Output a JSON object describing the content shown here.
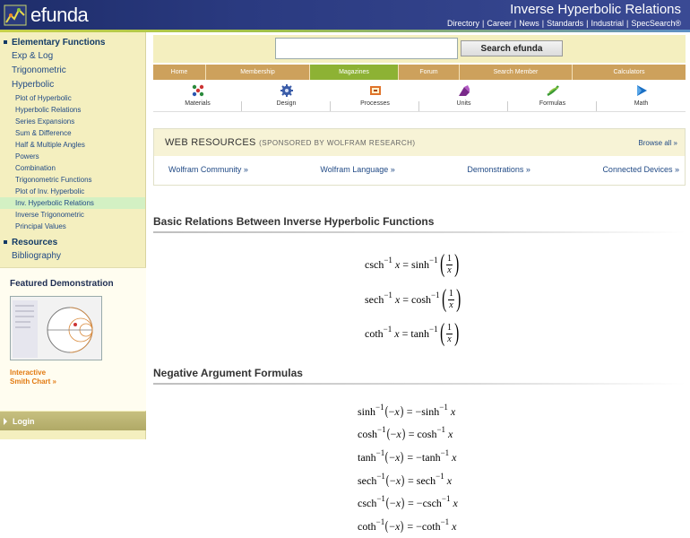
{
  "header": {
    "logo_text": "efunda",
    "page_heading": "Inverse Hyperbolic Relations",
    "top_links": [
      "Directory",
      "Career",
      "News",
      "Standards",
      "Industrial",
      "SpecSearch®"
    ]
  },
  "sidebar": {
    "section1": "Elementary Functions",
    "l1_items": [
      "Exp & Log",
      "Trigonometric",
      "Hyperbolic"
    ],
    "hyperbolic_items": [
      "Plot of Hyperbolic",
      "Hyperbolic Relations",
      "Series Expansions",
      "Sum & Difference",
      "Half & Multiple Angles",
      "Powers",
      "Combination",
      "Trigonometric Functions",
      "Plot of Inv. Hyperbolic",
      "Inv. Hyperbolic Relations",
      "Inverse Trigonometric",
      "Principal Values"
    ],
    "active_item": "Inv. Hyperbolic Relations",
    "section2": "Resources",
    "resources_items": [
      "Bibliography"
    ],
    "featured_title": "Featured Demonstration",
    "featured_caption_line1": "Interactive",
    "featured_caption_line2": "Smith Chart »",
    "login_label": "Login"
  },
  "search": {
    "placeholder": "",
    "button_label": "Search efunda"
  },
  "nav": {
    "tabs": [
      "Home",
      "Membership",
      "Magazines",
      "Forum",
      "Search Member",
      "Calculators"
    ],
    "active_tab": "Magazines"
  },
  "categories": [
    {
      "label": "Materials",
      "icon": "materials-icon"
    },
    {
      "label": "Design",
      "icon": "design-icon"
    },
    {
      "label": "Processes",
      "icon": "processes-icon"
    },
    {
      "label": "Units",
      "icon": "units-icon"
    },
    {
      "label": "Formulas",
      "icon": "formulas-icon"
    },
    {
      "label": "Math",
      "icon": "math-icon"
    }
  ],
  "web_resources": {
    "title": "WEB RESOURCES",
    "sponsor": "(SPONSORED BY WOLFRAM RESEARCH)",
    "browse_all": "Browse all »",
    "links": [
      "Wolfram Community »",
      "Wolfram Language »",
      "Demonstrations »",
      "Connected Devices »"
    ]
  },
  "sections": {
    "basic_title": "Basic Relations Between Inverse Hyperbolic Functions",
    "negative_title": "Negative Argument Formulas"
  },
  "math": {
    "neg_one": "−1",
    "var": "x",
    "one": "1",
    "basic": [
      {
        "lhs": "csch",
        "rhs": "sinh"
      },
      {
        "lhs": "sech",
        "rhs": "cosh"
      },
      {
        "lhs": "coth",
        "rhs": "tanh"
      }
    ],
    "negative": [
      {
        "fn": "sinh",
        "sign": "−"
      },
      {
        "fn": "cosh",
        "sign": ""
      },
      {
        "fn": "tanh",
        "sign": "−"
      },
      {
        "fn": "sech",
        "sign": ""
      },
      {
        "fn": "csch",
        "sign": "−"
      },
      {
        "fn": "coth",
        "sign": "−"
      }
    ]
  },
  "colors": {
    "header_bg": "#1e2d6a",
    "sidebar_bg": "#f4efbf",
    "nav_tab": "#cda15c",
    "nav_active": "#8db234",
    "link": "#224b86",
    "featured_caption": "#e27a12"
  }
}
